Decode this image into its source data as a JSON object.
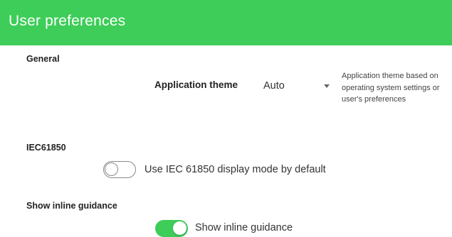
{
  "header": {
    "title": "User preferences"
  },
  "general": {
    "section_title": "General",
    "theme_label": "Application theme",
    "theme_value": "Auto",
    "theme_help": "Application theme based on operating system settings or user's preferences"
  },
  "iec": {
    "section_title": "IEC61850",
    "toggle_label": "Use IEC 61850 display mode by default",
    "toggle_state": "off"
  },
  "guidance": {
    "section_title": "Show inline guidance",
    "toggle_label": "Show inline guidance",
    "toggle_state": "on"
  },
  "colors": {
    "accent": "#3dcd58",
    "header_text": "#ffffff"
  },
  "icons": {
    "select_arrow": "chevron-down-icon"
  }
}
